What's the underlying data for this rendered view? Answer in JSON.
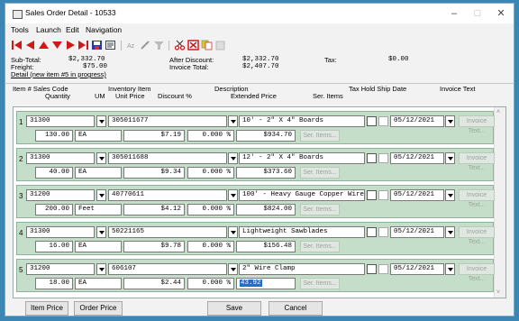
{
  "window": {
    "title": "Sales Order Detail - 10533",
    "minimize": "–",
    "maximize": "□",
    "close": "✕"
  },
  "menu": [
    "Tools",
    "Launch",
    "Edit",
    "Navigation"
  ],
  "totals": {
    "subtotal_label": "Sub-Total:",
    "subtotal": "$2,332.70",
    "freight_label": "Freight:",
    "freight": "$75.00",
    "after_discount_label": "After Discount:",
    "after_discount": "$2,332.70",
    "invoice_total_label": "Invoice Total:",
    "invoice_total": "$2,407.70",
    "tax_label": "Tax:",
    "tax": "$0.00",
    "detail_status": "Detail (new item #5 in progress)"
  },
  "headers": {
    "item_sales_code": "Item # Sales Code",
    "quantity": "Quantity",
    "um": "UM",
    "inventory_item": "Inventory Item",
    "unit_price": "Unit Price",
    "description": "Description",
    "discount": "Discount %",
    "extended_price": "Extended Price",
    "ser_items": "Ser. Items",
    "tax_hold_ship": "Tax Hold Ship Date",
    "invoice_text": "Invoice Text"
  },
  "rows": [
    {
      "num": "1",
      "sales_code": "31300",
      "item": "305011677",
      "description": "10' - 2\" X 4\" Boards",
      "qty": "130.00",
      "um": "EA",
      "price": "$7.19",
      "discount": "0.000 %",
      "extended": "$934.70",
      "ser": "Ser. Items...",
      "ship": "05/12/2021",
      "invoice_text": "Invoice Text..."
    },
    {
      "num": "2",
      "sales_code": "31300",
      "item": "305011688",
      "description": "12' - 2\" X 4\" Boards",
      "qty": "40.00",
      "um": "EA",
      "price": "$9.34",
      "discount": "0.000 %",
      "extended": "$373.60",
      "ser": "Ser. Items...",
      "ship": "05/12/2021",
      "invoice_text": "Invoice Text..."
    },
    {
      "num": "3",
      "sales_code": "31200",
      "item": "40770611",
      "description": "100' - Heavy Gauge Copper Wire",
      "qty": "200.00",
      "um": "Feet",
      "price": "$4.12",
      "discount": "0.000 %",
      "extended": "$824.00",
      "ser": "Ser. Items...",
      "ship": "05/12/2021",
      "invoice_text": "Invoice Text..."
    },
    {
      "num": "4",
      "sales_code": "31300",
      "item": "50221165",
      "description": "Lightweight Sawblades",
      "qty": "16.00",
      "um": "EA",
      "price": "$9.78",
      "discount": "0.000 %",
      "extended": "$156.48",
      "ser": "Ser. Items...",
      "ship": "05/12/2021",
      "invoice_text": "Invoice Text..."
    },
    {
      "num": "5",
      "sales_code": "31200",
      "item": "606107",
      "description": "2\" Wire Clamp",
      "qty": "18.00",
      "um": "EA",
      "price": "$2.44",
      "discount": "0.000 %",
      "extended": "43.92",
      "ser": "Ser. Items...",
      "ship": "05/12/2021",
      "invoice_text": "Invoice Text..."
    }
  ],
  "buttons": {
    "item_price": "Item Price",
    "order_price": "Order Price",
    "save": "Save",
    "cancel": "Cancel"
  },
  "colors": {
    "row_bg": "#c5dec9",
    "selection": "#1f6fd0",
    "desktop": "#3c86b5"
  }
}
